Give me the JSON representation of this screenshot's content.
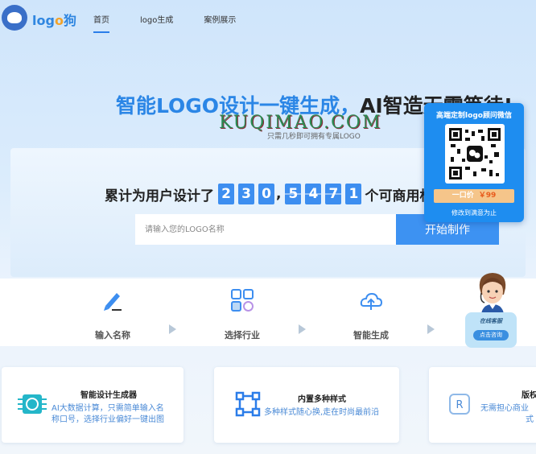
{
  "header": {
    "logo_text_a": "log",
    "logo_text_b": "o",
    "logo_text_c": "狗",
    "nav": [
      {
        "label": "首页",
        "active": true
      },
      {
        "label": "logo生成",
        "active": false
      },
      {
        "label": "案例展示",
        "active": false
      }
    ]
  },
  "hero": {
    "title_blue": "智能LOGO设计一键生成，",
    "title_dark": "AI智造无需等待!",
    "watermark": "KUQIMAO.COM",
    "subtitle": "只需几秒即可拥有专属LOGO"
  },
  "counter": {
    "label": "累计为用户设计了",
    "digits": [
      "2",
      "3",
      "0",
      "5",
      "4",
      "7",
      "1"
    ],
    "suffix": "个可商用标志LOGO作品"
  },
  "search": {
    "placeholder": "请输入您的LOGO名称",
    "button": "开始制作"
  },
  "steps": [
    {
      "label": "输入名称",
      "icon": "pen-icon"
    },
    {
      "label": "选择行业",
      "icon": "grid-icon"
    },
    {
      "label": "智能生成",
      "icon": "cloud-icon"
    }
  ],
  "features": [
    {
      "title": "智能设计生成器",
      "desc1": "AI大数据计算，只需简单输入名",
      "desc2": "称口号，选择行业偏好一键出图",
      "icon": "brain-chip-icon"
    },
    {
      "title": "内置多种样式",
      "desc1": "多种样式随心换,走在时尚最前沿",
      "desc2": "",
      "icon": "nodes-icon"
    },
    {
      "title": "版权",
      "desc1": "无需担心商业",
      "desc2": "式",
      "icon": "copyright-icon"
    }
  ],
  "popup": {
    "title": "高端定制logo顾问微信",
    "price_label": "一口价",
    "price_value": "￥99",
    "note": "修改到满意为止"
  },
  "support": {
    "title": "在线客服",
    "button": "点击咨询"
  }
}
